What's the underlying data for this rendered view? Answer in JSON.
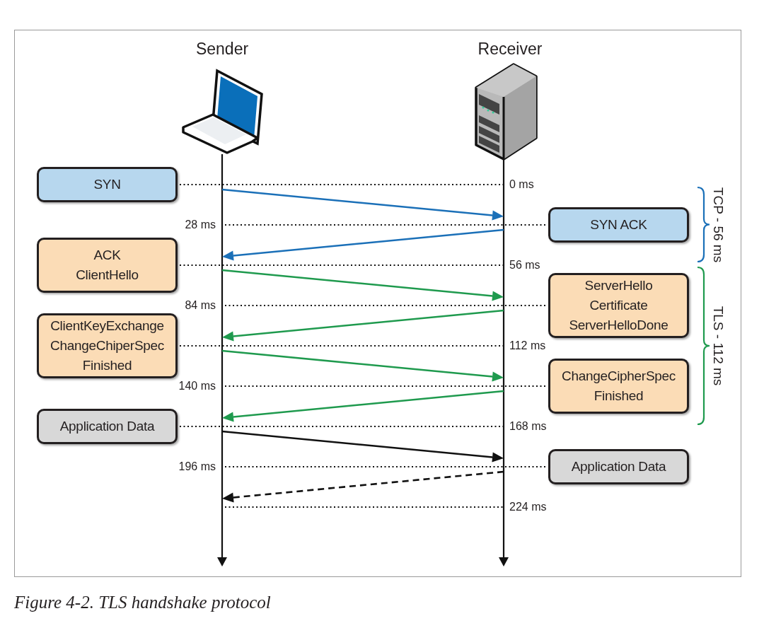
{
  "actors": [
    {
      "name": "Sender"
    },
    {
      "name": "Receiver"
    }
  ],
  "rows": [
    {
      "time": "0 ms",
      "message": {
        "lines": [
          "SYN"
        ],
        "kind": "tcp"
      },
      "arrow": {
        "color": "#1b70b8",
        "dashed": false
      }
    },
    {
      "time": "28 ms",
      "message": {
        "lines": [
          "SYN ACK"
        ],
        "kind": "tcp"
      },
      "arrow": {
        "color": "#1b70b8",
        "dashed": false
      }
    },
    {
      "time": "56 ms",
      "message": {
        "lines": [
          "ACK",
          "ClientHello"
        ],
        "kind": "tls"
      },
      "arrow": {
        "color": "#1f9a4e",
        "dashed": false
      }
    },
    {
      "time": "84 ms",
      "message": {
        "lines": [
          "ServerHello",
          "Certificate",
          "ServerHelloDone"
        ],
        "kind": "tls"
      },
      "arrow": {
        "color": "#1f9a4e",
        "dashed": false
      }
    },
    {
      "time": "112 ms",
      "message": {
        "lines": [
          "ClientKeyExchange",
          "ChangeChiperSpec",
          "Finished"
        ],
        "kind": "tls"
      },
      "arrow": {
        "color": "#1f9a4e",
        "dashed": false
      }
    },
    {
      "time": "140 ms",
      "message": {
        "lines": [
          "ChangeCipherSpec",
          "Finished"
        ],
        "kind": "tls"
      },
      "arrow": {
        "color": "#1f9a4e",
        "dashed": false
      }
    },
    {
      "time": "168 ms",
      "message": {
        "lines": [
          "Application Data"
        ],
        "kind": "data"
      },
      "arrow": {
        "color": "#111111",
        "dashed": false
      }
    },
    {
      "time": "196 ms",
      "message": {
        "lines": [
          "Application Data"
        ],
        "kind": "data"
      },
      "arrow": {
        "color": "#111111",
        "dashed": true
      }
    },
    {
      "time": "224 ms"
    }
  ],
  "brackets": [
    {
      "label": "TCP - 56 ms",
      "color": "#1b70b8"
    },
    {
      "label": "TLS - 112 ms",
      "color": "#1f9a4e"
    }
  ],
  "caption": "Figure 4-2. TLS handshake protocol"
}
